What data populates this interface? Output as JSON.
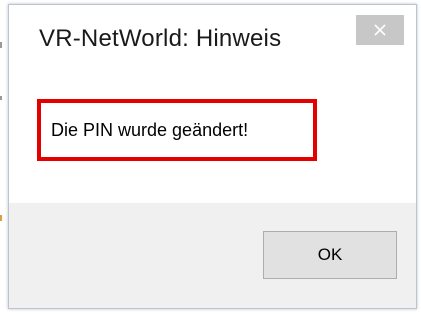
{
  "dialog": {
    "title": "VR-NetWorld: Hinweis",
    "close_icon": "close-icon",
    "message": "Die PIN wurde geändert!",
    "ok_label": "OK"
  },
  "colors": {
    "highlight_border": "#e50000",
    "close_button_bg": "#c7c7c7",
    "footer_bg": "#f0f0f0"
  }
}
